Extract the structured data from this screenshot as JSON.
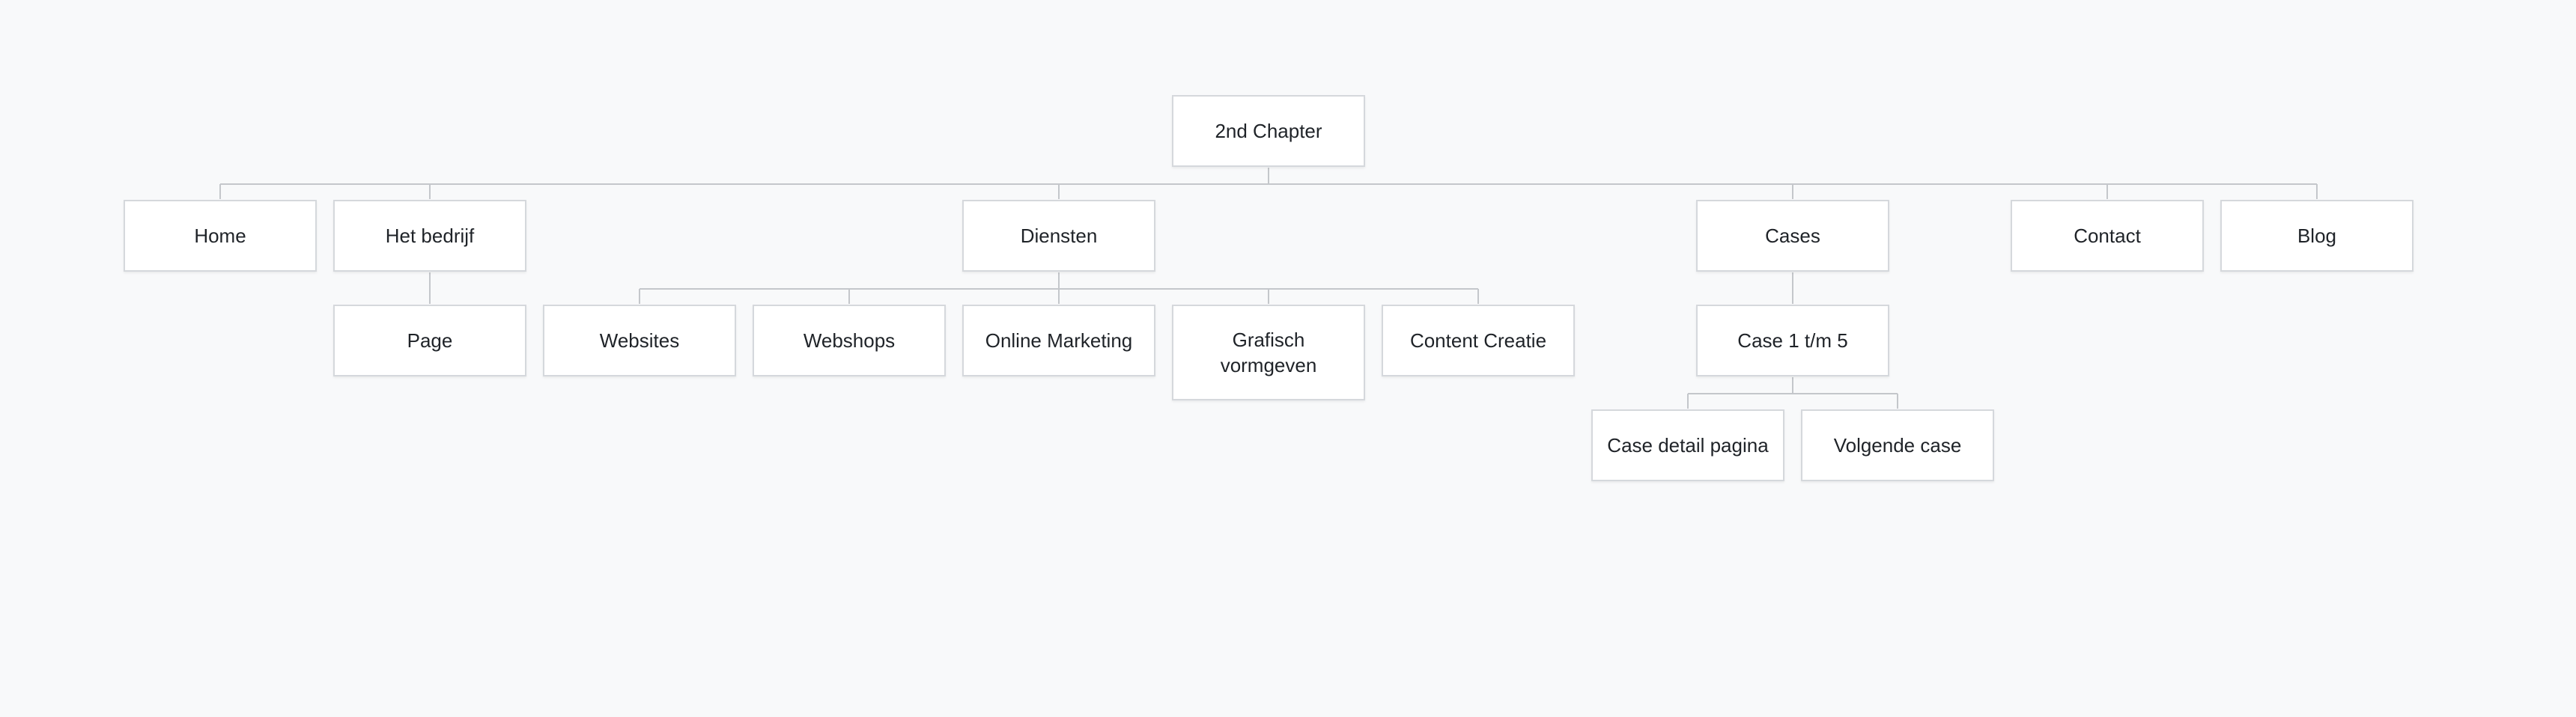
{
  "sitemap": {
    "root": {
      "label": "2nd Chapter"
    },
    "level1": {
      "home": "Home",
      "het_bedrijf": "Het bedrijf",
      "diensten": "Diensten",
      "cases": "Cases",
      "contact": "Contact",
      "blog": "Blog"
    },
    "het_bedrijf_children": {
      "page": "Page"
    },
    "diensten_children": {
      "websites": "Websites",
      "webshops": "Webshops",
      "online_marketing": "Online Marketing",
      "grafisch_vormgeven": "Grafisch vormgeven",
      "content_creatie": "Content Creatie"
    },
    "cases_children": {
      "case_1_5": "Case 1 t/m 5"
    },
    "case_children": {
      "case_detail": "Case detail pagina",
      "volgende_case": "Volgende case"
    }
  },
  "colors": {
    "background": "#f8f9fa",
    "node_fill": "#ffffff",
    "node_border": "#d5d8dc",
    "connector": "#c4c7cb",
    "text": "#1f2328"
  }
}
